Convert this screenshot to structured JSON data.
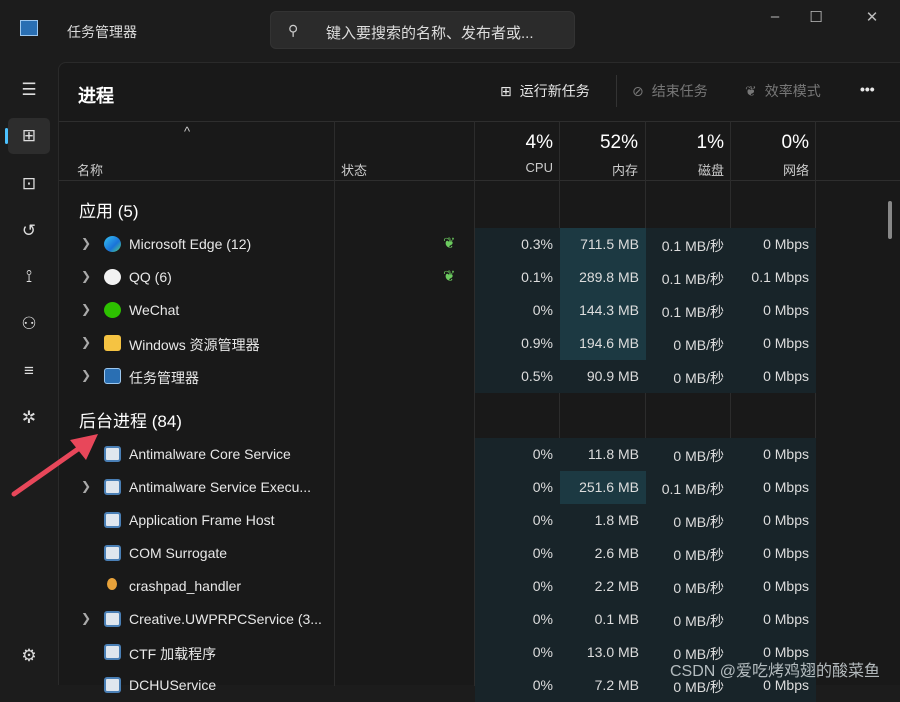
{
  "window": {
    "title": "任务管理器",
    "search_placeholder": "键入要搜索的名称、发布者或...",
    "minimize": "–",
    "maximize": "☐",
    "close": "✕"
  },
  "toolbar": {
    "page_title": "进程",
    "run_new_task": "运行新任务",
    "end_task": "结束任务",
    "efficiency_mode": "效率模式",
    "more": "•••"
  },
  "header": {
    "name": "名称",
    "status": "状态",
    "cpu_pct": "4%",
    "cpu": "CPU",
    "mem_pct": "52%",
    "mem": "内存",
    "disk_pct": "1%",
    "disk": "磁盘",
    "net_pct": "0%",
    "net": "网络",
    "sort": "^"
  },
  "groups": {
    "apps": "应用 (5)",
    "background": "后台进程 (84)"
  },
  "apps": [
    {
      "name": "Microsoft Edge (12)",
      "cpu": "0.3%",
      "mem": "711.5 MB",
      "disk": "0.1 MB/秒",
      "net": "0 Mbps",
      "eff": true,
      "icon": "edge",
      "expand": true
    },
    {
      "name": "QQ (6)",
      "cpu": "0.1%",
      "mem": "289.8 MB",
      "disk": "0.1 MB/秒",
      "net": "0.1 Mbps",
      "eff": true,
      "icon": "qq",
      "expand": true
    },
    {
      "name": "WeChat",
      "cpu": "0%",
      "mem": "144.3 MB",
      "disk": "0.1 MB/秒",
      "net": "0 Mbps",
      "icon": "wechat",
      "expand": true
    },
    {
      "name": "Windows 资源管理器",
      "cpu": "0.9%",
      "mem": "194.6 MB",
      "disk": "0 MB/秒",
      "net": "0 Mbps",
      "icon": "folder",
      "expand": true
    },
    {
      "name": "任务管理器",
      "cpu": "0.5%",
      "mem": "90.9 MB",
      "disk": "0 MB/秒",
      "net": "0 Mbps",
      "icon": "taskmgr",
      "expand": true
    }
  ],
  "background": [
    {
      "name": "Antimalware Core Service",
      "cpu": "0%",
      "mem": "11.8 MB",
      "disk": "0 MB/秒",
      "net": "0 Mbps",
      "icon": "service"
    },
    {
      "name": "Antimalware Service Execu...",
      "cpu": "0%",
      "mem": "251.6 MB",
      "disk": "0.1 MB/秒",
      "net": "0 Mbps",
      "icon": "service",
      "expand": true
    },
    {
      "name": "Application Frame Host",
      "cpu": "0%",
      "mem": "1.8 MB",
      "disk": "0 MB/秒",
      "net": "0 Mbps",
      "icon": "service"
    },
    {
      "name": "COM Surrogate",
      "cpu": "0%",
      "mem": "2.6 MB",
      "disk": "0 MB/秒",
      "net": "0 Mbps",
      "icon": "service"
    },
    {
      "name": "crashpad_handler",
      "cpu": "0%",
      "mem": "2.2 MB",
      "disk": "0 MB/秒",
      "net": "0 Mbps",
      "icon": "crashpad"
    },
    {
      "name": "Creative.UWPRPCService (3...",
      "cpu": "0%",
      "mem": "0.1 MB",
      "disk": "0 MB/秒",
      "net": "0 Mbps",
      "icon": "service",
      "expand": true
    },
    {
      "name": "CTF 加载程序",
      "cpu": "0%",
      "mem": "13.0 MB",
      "disk": "0 MB/秒",
      "net": "0 Mbps",
      "icon": "service"
    },
    {
      "name": "DCHUService",
      "cpu": "0%",
      "mem": "7.2 MB",
      "disk": "0 MB/秒",
      "net": "0 Mbps",
      "icon": "service"
    }
  ],
  "watermark": "CSDN @爱吃烤鸡翅的酸菜鱼",
  "colors": {
    "accent": "#4cc2ff",
    "leaf": "#6ccb5f",
    "arrow": "#e8475a",
    "mem_highlight": "#1c3942"
  }
}
